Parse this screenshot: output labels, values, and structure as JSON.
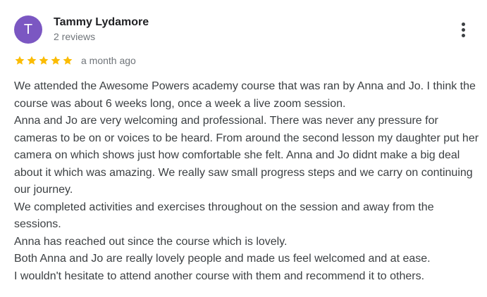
{
  "reviewer": {
    "avatar_letter": "T",
    "avatar_color": "#7b57c2",
    "name": "Tammy Lydamore",
    "review_count": "2 reviews"
  },
  "more_options_icon": "more-vert-icon",
  "rating": {
    "stars": 5,
    "max_stars": 5,
    "star_color": "#fbbc04",
    "date": "a month ago"
  },
  "review": {
    "paragraphs": [
      "We attended the Awesome Powers academy course that was ran by Anna and Jo. I think the course was about 6 weeks long, once a week a live zoom session.",
      "Anna and Jo are very welcoming and professional. There was never any pressure for cameras to be on or voices to be heard. From around the second lesson my daughter put her camera on which shows just how comfortable she felt. Anna and Jo didnt make a big deal about it which was amazing. We really saw small progress steps and we carry on continuing our journey.",
      "We completed activities and exercises throughout on the session and away from the sessions.",
      "Anna has reached out since the course which is lovely.",
      "Both Anna and Jo are really lovely people and made us feel welcomed and at ease.",
      "I wouldn't hesitate to attend another course with them and recommend it to others."
    ]
  }
}
